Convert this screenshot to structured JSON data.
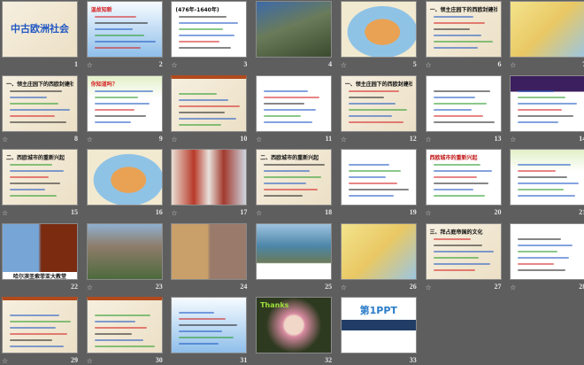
{
  "view": "slide-sorter",
  "animation_icon": "☆",
  "slides": [
    {
      "number": "1",
      "kind": "parchment",
      "title": "中古欧洲社会",
      "title_color": "#1f57c3",
      "animated": false
    },
    {
      "number": "2",
      "kind": "blue",
      "title": "温故知新",
      "title_color": "#d62020",
      "animated": true
    },
    {
      "number": "3",
      "kind": "white",
      "title": "(476年-1640年)",
      "title_color": "#111111",
      "animated": true
    },
    {
      "number": "4",
      "kind": "photo",
      "title": "",
      "title_color": "#ff0000",
      "animated": false
    },
    {
      "number": "5",
      "kind": "map",
      "title": "",
      "title_color": "#111111",
      "animated": true
    },
    {
      "number": "6",
      "kind": "parchment",
      "title": "一、领主庄园下的西欧封建社会",
      "title_color": "#111111",
      "animated": true
    },
    {
      "number": "7",
      "kind": "mapy",
      "title": "",
      "title_color": "#111111",
      "animated": true
    },
    {
      "number": "8",
      "kind": "parchment",
      "title": "一、领主庄园下的西欧封建社会",
      "title_color": "#111111",
      "animated": true
    },
    {
      "number": "9",
      "kind": "green",
      "title": "你知道吗？",
      "title_color": "#d62020",
      "animated": true
    },
    {
      "number": "10",
      "kind": "parchment-red",
      "title": "",
      "title_color": "#d62020",
      "animated": true
    },
    {
      "number": "11",
      "kind": "white",
      "title": "",
      "title_color": "#d62020",
      "animated": true
    },
    {
      "number": "12",
      "kind": "parchment",
      "title": "一、领主庄园下的西欧封建社会",
      "title_color": "#111111",
      "animated": true
    },
    {
      "number": "13",
      "kind": "white",
      "title": "",
      "title_color": "#111111",
      "animated": true
    },
    {
      "number": "14",
      "kind": "purple",
      "title": "",
      "title_color": "#ffd84a",
      "animated": true
    },
    {
      "number": "15",
      "kind": "parchment",
      "title": "二、西欧城市的重新兴起",
      "title_color": "#111111",
      "animated": true
    },
    {
      "number": "16",
      "kind": "map",
      "title": "",
      "title_color": "#111111",
      "animated": false
    },
    {
      "number": "17",
      "kind": "street",
      "title": "",
      "title_color": "#111111",
      "animated": true
    },
    {
      "number": "18",
      "kind": "parchment",
      "title": "二、西欧城市的重新兴起",
      "title_color": "#111111",
      "animated": true
    },
    {
      "number": "19",
      "kind": "white",
      "title": "",
      "title_color": "#111111",
      "animated": false
    },
    {
      "number": "20",
      "kind": "white",
      "title": "西欧城市的重新兴起",
      "title_color": "#c01010",
      "animated": true
    },
    {
      "number": "21",
      "kind": "green",
      "title": "",
      "title_color": "#111111",
      "animated": false
    },
    {
      "number": "22",
      "kind": "church",
      "title": "哈尔滨圣索菲亚大教堂",
      "title_color": "#111111",
      "animated": false
    },
    {
      "number": "23",
      "kind": "city",
      "title": "",
      "title_color": "#111111",
      "animated": true
    },
    {
      "number": "24",
      "kind": "collage",
      "title": "",
      "title_color": "#111111",
      "animated": false
    },
    {
      "number": "25",
      "kind": "river",
      "title": "",
      "title_color": "#111111",
      "animated": false
    },
    {
      "number": "26",
      "kind": "mapy",
      "title": "",
      "title_color": "#111111",
      "animated": true
    },
    {
      "number": "27",
      "kind": "parchment",
      "title": "三、拜占庭帝国的文化",
      "title_color": "#111111",
      "animated": true
    },
    {
      "number": "28",
      "kind": "white",
      "title": "",
      "title_color": "#d62020",
      "animated": true
    },
    {
      "number": "29",
      "kind": "parchment-red",
      "title": "",
      "title_color": "#1f57c3",
      "animated": true
    },
    {
      "number": "30",
      "kind": "parchment-red",
      "title": "",
      "title_color": "#1f57c3",
      "animated": true
    },
    {
      "number": "31",
      "kind": "blue",
      "title": "",
      "title_color": "#111111",
      "animated": false
    },
    {
      "number": "32",
      "kind": "angel",
      "title": "Thanks",
      "title_color": "#9be03a",
      "animated": false
    },
    {
      "number": "33",
      "kind": "brand",
      "title": "第1PPT",
      "title_color": "#2a7cc9",
      "animated": false
    }
  ]
}
